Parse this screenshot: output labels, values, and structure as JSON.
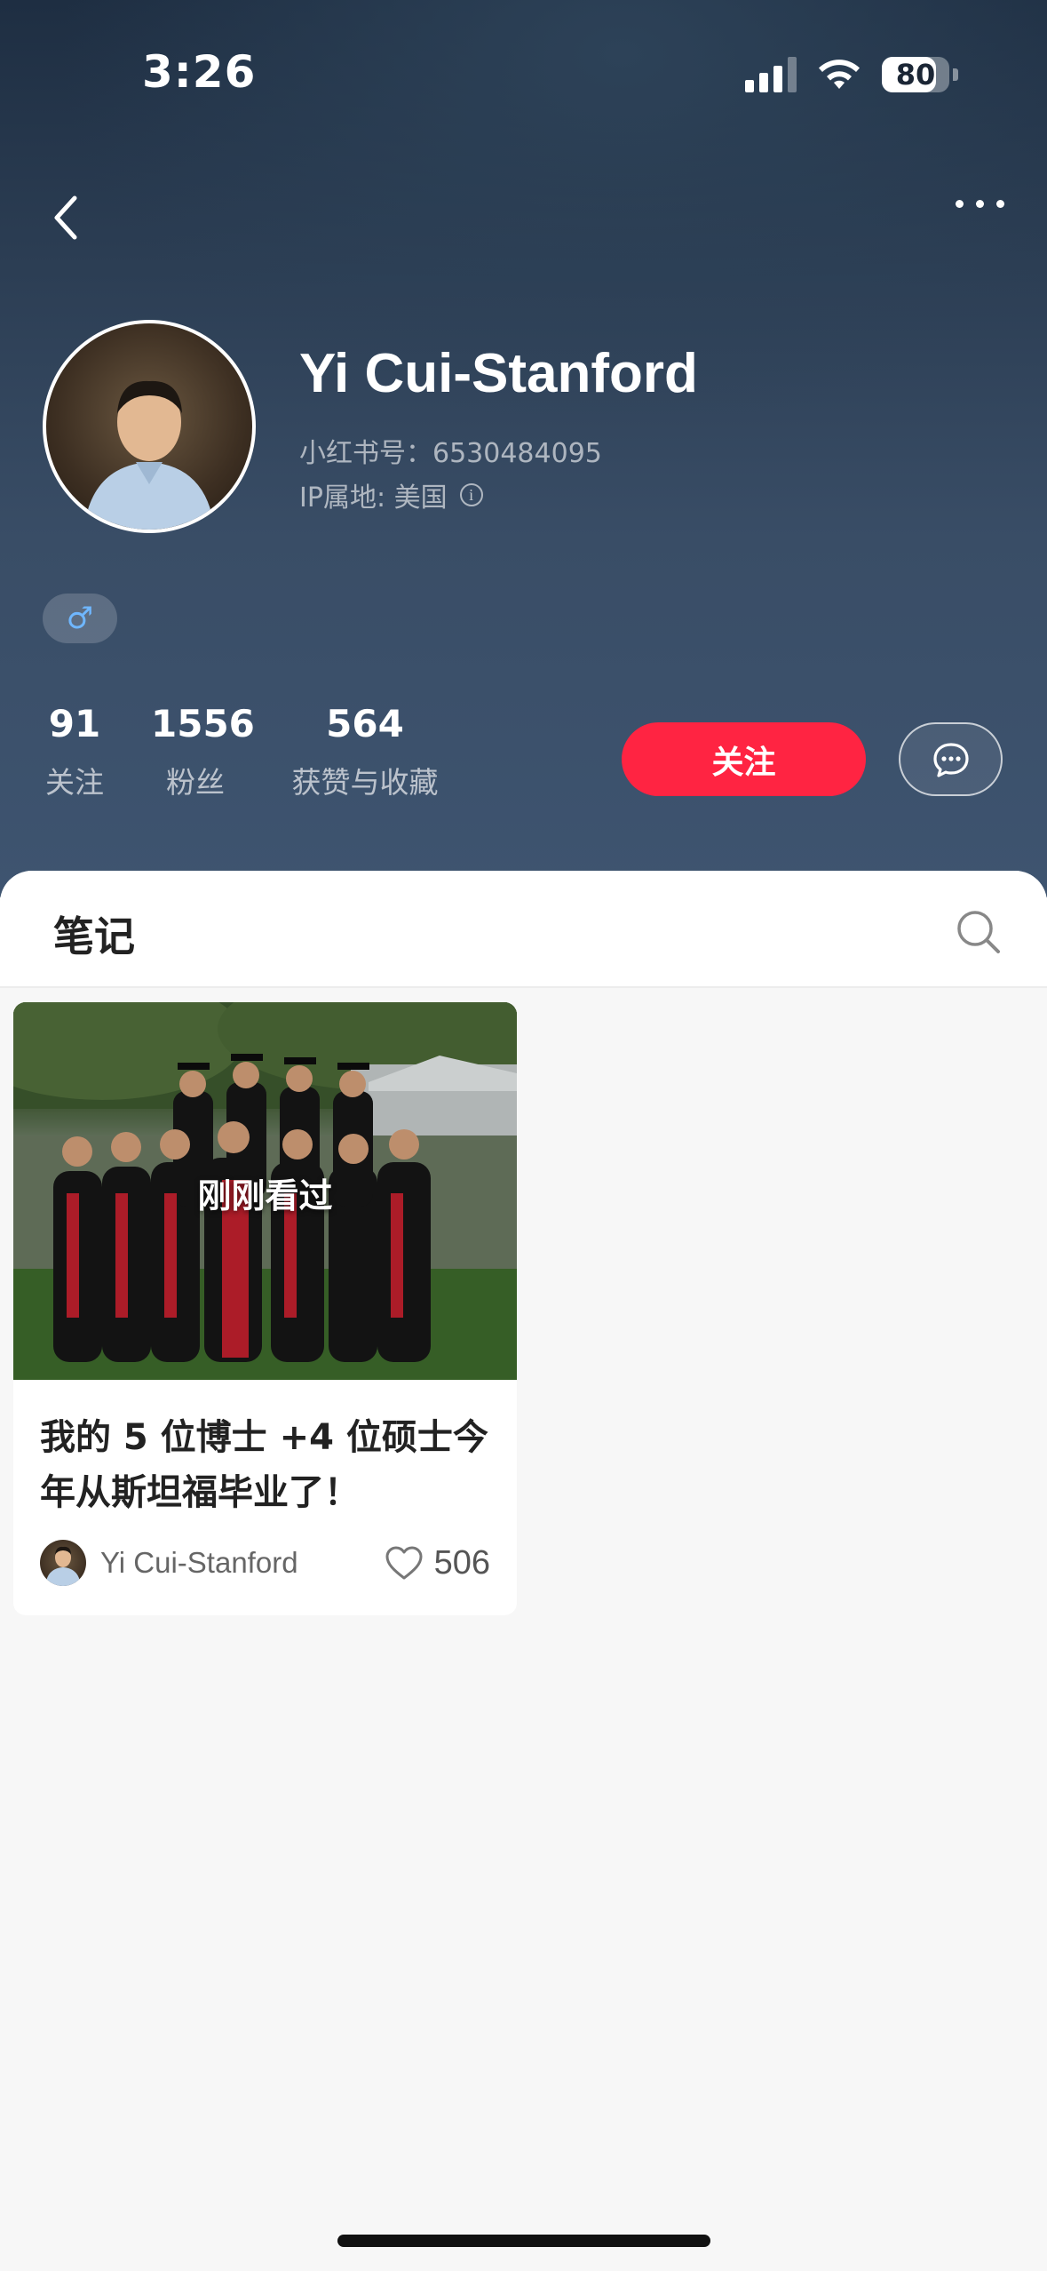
{
  "status_bar": {
    "time": "3:26",
    "battery": "80"
  },
  "profile": {
    "name": "Yi Cui-Stanford",
    "id_line": "小红书号：6530484095",
    "ip_line": "IP属地: 美国",
    "gender_symbol": "♂"
  },
  "stats": [
    {
      "value": "91",
      "label": "关注"
    },
    {
      "value": "1556",
      "label": "粉丝"
    },
    {
      "value": "564",
      "label": "获赞与收藏"
    }
  ],
  "actions": {
    "follow_label": "关注"
  },
  "tabs": {
    "notes_label": "笔记"
  },
  "notes": [
    {
      "image_label": "刚刚看过",
      "title": "我的 5 位博士 +4 位硕士今年从斯坦福毕业了！",
      "author": "Yi Cui-Stanford",
      "likes": "506"
    }
  ],
  "colors": {
    "accent": "#ff2442",
    "header": "#2c3e54"
  }
}
